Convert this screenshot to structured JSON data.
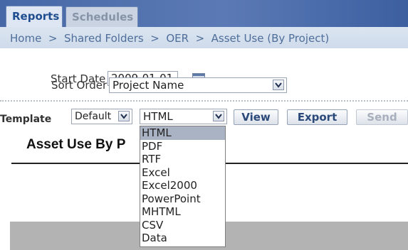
{
  "tabs": [
    {
      "label": "Reports",
      "active": true
    },
    {
      "label": "Schedules",
      "active": false
    }
  ],
  "breadcrumb": "Home  >  Shared Folders  >  OER  >  Asset Use (By Project)",
  "form": {
    "start_date_label": "Start Date",
    "start_date_value": "2009-01-01",
    "sort_order_label": "Sort Order",
    "sort_order_value": "Project Name"
  },
  "toolbar": {
    "template_label": "Template",
    "template_value": "Default",
    "format_value": "HTML",
    "view_label": "View",
    "export_label": "Export",
    "send_label": "Send"
  },
  "report": {
    "title_visible": "Asset Use By P"
  },
  "format_options": [
    "HTML",
    "PDF",
    "RTF",
    "Excel",
    "Excel2000",
    "PowerPoint",
    "MHTML",
    "CSV",
    "Data"
  ],
  "colors": {
    "tabbar": "#4668a6",
    "active_tab_text": "#1f4d8f",
    "breadcrumb_text": "#4f6e99",
    "selected_option": "#aab3c4"
  }
}
